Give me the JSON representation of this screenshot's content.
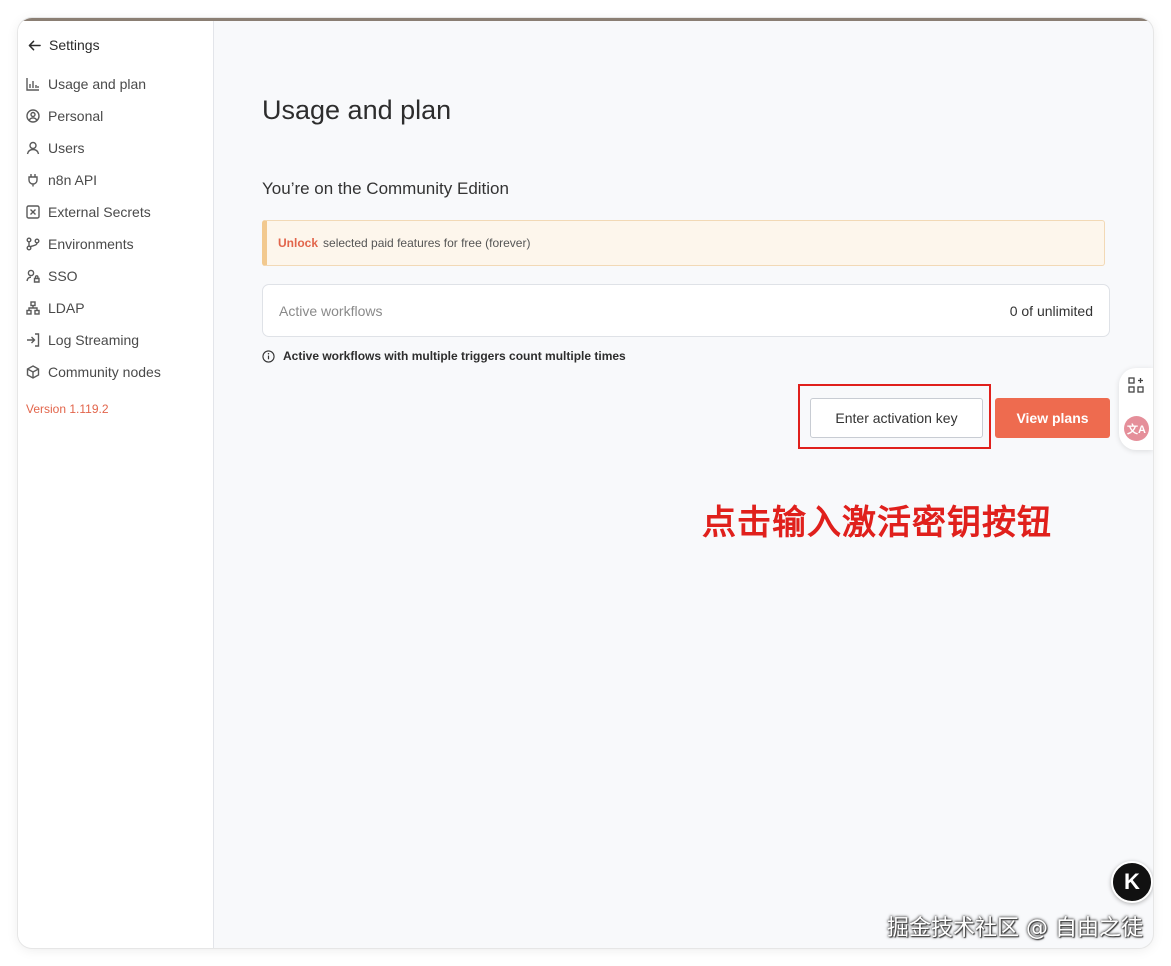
{
  "sidebar": {
    "back_label": "Settings",
    "items": [
      {
        "label": "Usage and plan",
        "icon": "bar-chart-icon"
      },
      {
        "label": "Personal",
        "icon": "user-circle-icon"
      },
      {
        "label": "Users",
        "icon": "user-icon"
      },
      {
        "label": "n8n API",
        "icon": "plug-icon"
      },
      {
        "label": "External Secrets",
        "icon": "vault-icon"
      },
      {
        "label": "Environments",
        "icon": "git-branch-icon"
      },
      {
        "label": "SSO",
        "icon": "user-lock-icon"
      },
      {
        "label": "LDAP",
        "icon": "network-icon"
      },
      {
        "label": "Log Streaming",
        "icon": "sign-in-icon"
      },
      {
        "label": "Community nodes",
        "icon": "cube-icon"
      }
    ],
    "version": "Version 1.119.2"
  },
  "main": {
    "title": "Usage and plan",
    "edition": "You’re on the Community Edition",
    "callout": {
      "link": "Unlock",
      "text": "selected paid features for free (forever)"
    },
    "usage": {
      "label": "Active workflows",
      "value": "0 of unlimited"
    },
    "note": "Active workflows with multiple triggers count multiple times",
    "buttons": {
      "activation_key": "Enter activation key",
      "view_plans": "View plans"
    }
  },
  "annotation": "点击输入激活密钥按钮",
  "overlay": {
    "translate_label": "文A",
    "badge_letter": "K",
    "watermark": "掘金技术社区 @ 自由之徒"
  },
  "colors": {
    "accent": "#ee6b4f",
    "version_text": "#e2654b",
    "annotation_red": "#e0201c",
    "callout_bg": "#fdf6ec"
  }
}
